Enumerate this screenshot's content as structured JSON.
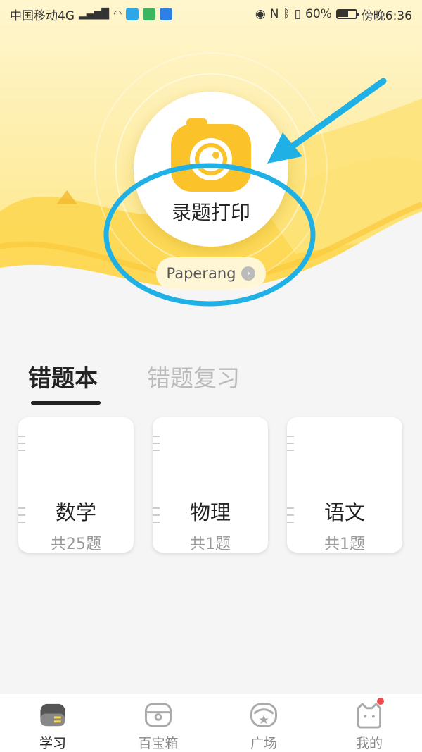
{
  "status_bar": {
    "carrier": "中国移动4G",
    "network_badge": "4G",
    "battery_text": "60%",
    "battery_level": 0.6,
    "time": "傍晚6:36"
  },
  "hero": {
    "main_button_label": "录题打印",
    "paperang_label": "Paperang"
  },
  "tabs": [
    {
      "label": "错题本",
      "active": true
    },
    {
      "label": "错题复习",
      "active": false
    }
  ],
  "subjects": [
    {
      "title": "数学",
      "count": "共25题"
    },
    {
      "title": "物理",
      "count": "共1题"
    },
    {
      "title": "语文",
      "count": "共1题"
    }
  ],
  "bottom_nav": [
    {
      "label": "学习",
      "icon": "study-icon",
      "active": true
    },
    {
      "label": "百宝箱",
      "icon": "treasure-box-icon",
      "active": false
    },
    {
      "label": "广场",
      "icon": "square-icon",
      "active": false
    },
    {
      "label": "我的",
      "icon": "profile-cat-icon",
      "active": false,
      "has_badge": true
    }
  ],
  "colors": {
    "hero_yellow": "#fcd94a",
    "hero_light": "#fff4b8",
    "accent_blue": "#1fb0e6",
    "badge_red": "#f04a4a"
  }
}
